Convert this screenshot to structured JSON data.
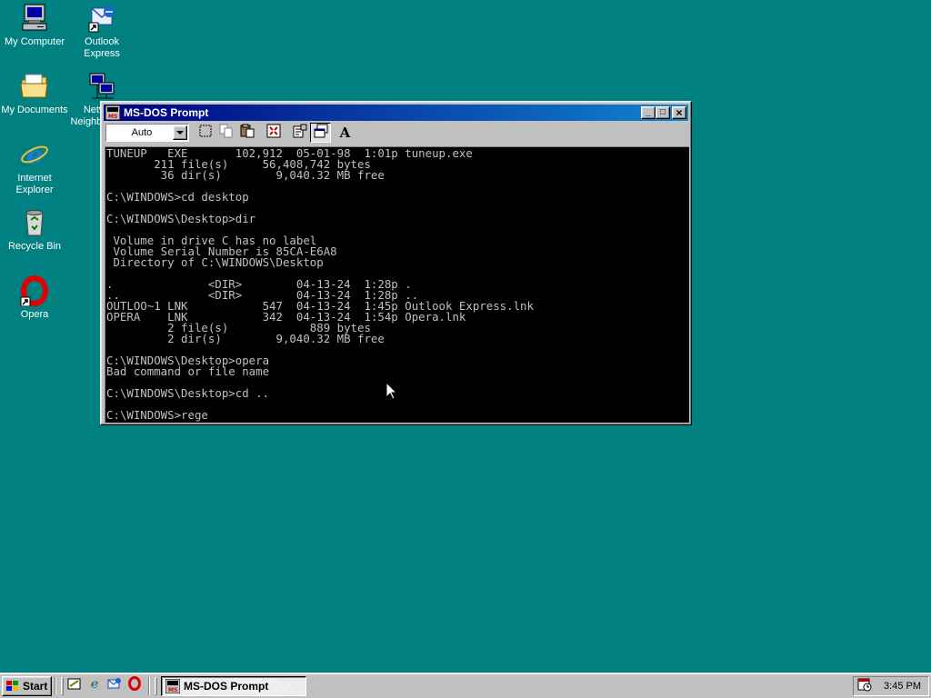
{
  "desktop": {
    "icons": [
      {
        "label": "My Computer",
        "icon": "computer-icon"
      },
      {
        "label": "Outlook Express",
        "icon": "outlook-express-icon"
      },
      {
        "label": "My Documents",
        "icon": "folder-icon"
      },
      {
        "label": "Network Neighborhood",
        "icon": "network-icon"
      },
      {
        "label": "Internet Explorer",
        "icon": "internet-explorer-icon"
      },
      {
        "label": "Recycle Bin",
        "icon": "recycle-bin-icon"
      },
      {
        "label": "Opera",
        "icon": "opera-icon"
      }
    ]
  },
  "window": {
    "title": "MS-DOS Prompt",
    "app_icon": "ms-dos-icon",
    "minimize_glyph": "_",
    "maximize_glyph": "□",
    "close_glyph": "×",
    "toolbar": {
      "font_size_value": "Auto",
      "buttons": [
        "mark-icon",
        "copy-icon",
        "paste-icon",
        "full-screen-icon",
        "properties-icon",
        "background-icon",
        "font-icon"
      ],
      "font_button_glyph": "A"
    },
    "console_lines": [
      "TUNEUP   EXE       102,912  05-01-98  1:01p tuneup.exe",
      "       211 file(s)     56,408,742 bytes",
      "        36 dir(s)        9,040.32 MB free",
      "",
      "C:\\WINDOWS>cd desktop",
      "",
      "C:\\WINDOWS\\Desktop>dir",
      "",
      " Volume in drive C has no label",
      " Volume Serial Number is 85CA-E6A8",
      " Directory of C:\\WINDOWS\\Desktop",
      "",
      ".              <DIR>        04-13-24  1:28p .",
      "..             <DIR>        04-13-24  1:28p ..",
      "OUTLOO~1 LNK           547  04-13-24  1:45p Outlook Express.lnk",
      "OPERA    LNK           342  04-13-24  1:54p Opera.lnk",
      "         2 file(s)            889 bytes",
      "         2 dir(s)        9,040.32 MB free",
      "",
      "C:\\WINDOWS\\Desktop>opera",
      "Bad command or file name",
      "",
      "C:\\WINDOWS\\Desktop>cd ..",
      "",
      "C:\\WINDOWS>rege"
    ]
  },
  "taskbar": {
    "start_label": "Start",
    "quick_launch": [
      "show-desktop-icon",
      "internet-explorer-icon",
      "outlook-express-icon",
      "opera-icon"
    ],
    "tasks": [
      {
        "label": "MS-DOS Prompt",
        "icon": "ms-dos-icon"
      }
    ],
    "tray": {
      "clock": "3:45 PM",
      "icons": [
        "scheduler-icon"
      ]
    }
  },
  "colors": {
    "desktop": "#008080",
    "title_active_start": "#000080",
    "title_active_end": "#1084d0",
    "console_bg": "#000000",
    "console_fg": "#c0c0c0"
  }
}
